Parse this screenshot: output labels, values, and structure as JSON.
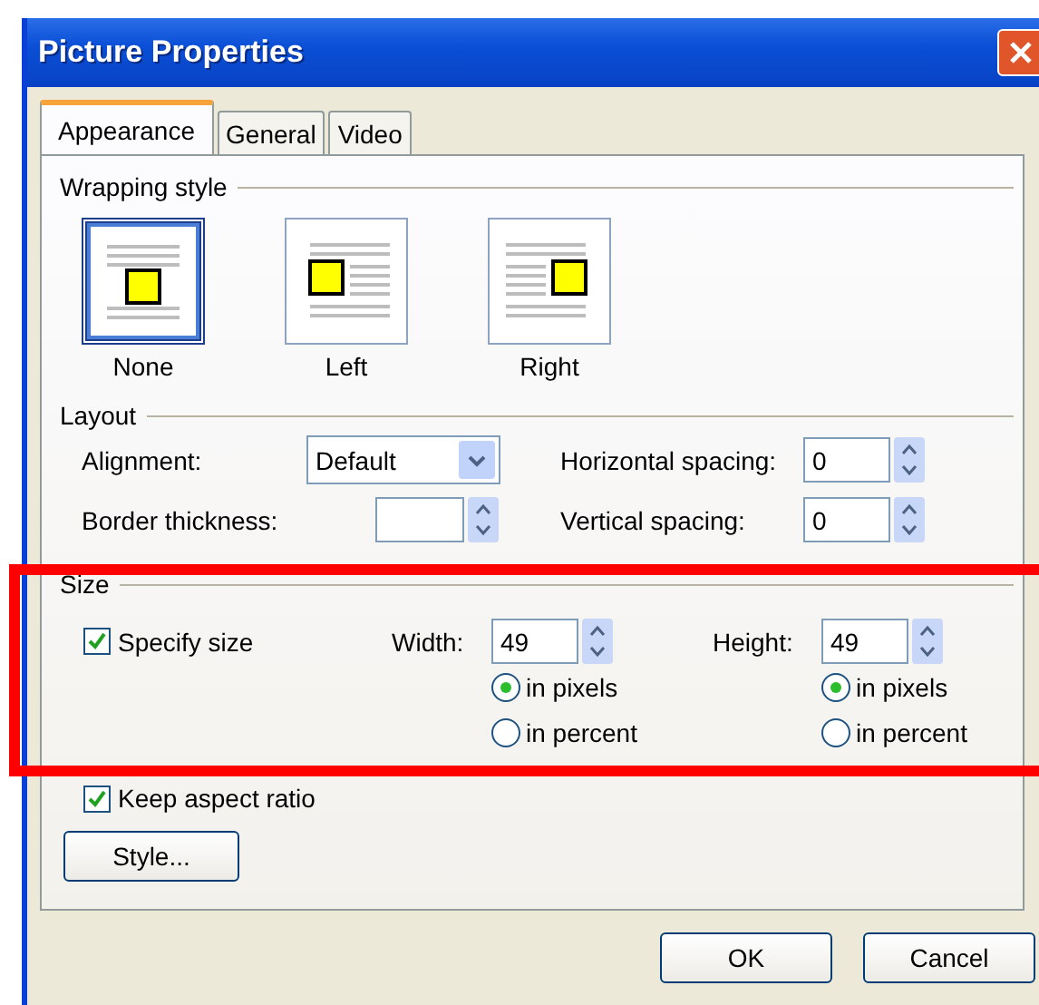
{
  "window": {
    "title": "Picture Properties"
  },
  "tabs": [
    {
      "label": "Appearance",
      "selected": true
    },
    {
      "label": "General",
      "selected": false
    },
    {
      "label": "Video",
      "selected": false
    }
  ],
  "wrapping": {
    "heading": "Wrapping style",
    "options": [
      {
        "label": "None",
        "kind": "none",
        "selected": true
      },
      {
        "label": "Left",
        "kind": "left",
        "selected": false
      },
      {
        "label": "Right",
        "kind": "right",
        "selected": false
      }
    ]
  },
  "layout": {
    "heading": "Layout",
    "alignment": {
      "label": "Alignment:",
      "value": "Default"
    },
    "border_thickness": {
      "label": "Border thickness:"
    },
    "horizontal_spacing": {
      "label": "Horizontal spacing:",
      "value": "0"
    },
    "vertical_spacing": {
      "label": "Vertical spacing:",
      "value": "0"
    }
  },
  "size": {
    "heading": "Size",
    "specify_size": {
      "label": "Specify size",
      "checked": true
    },
    "width": {
      "label": "Width:",
      "value": "49",
      "units": [
        {
          "label": "in pixels",
          "selected": true
        },
        {
          "label": "in percent",
          "selected": false
        }
      ]
    },
    "height": {
      "label": "Height:",
      "value": "49",
      "units": [
        {
          "label": "in pixels",
          "selected": true
        },
        {
          "label": "in percent",
          "selected": false
        }
      ]
    },
    "keep_aspect_ratio": {
      "label": "Keep aspect ratio",
      "checked": true
    }
  },
  "style_button": "Style...",
  "buttons": [
    "OK",
    "Cancel"
  ]
}
